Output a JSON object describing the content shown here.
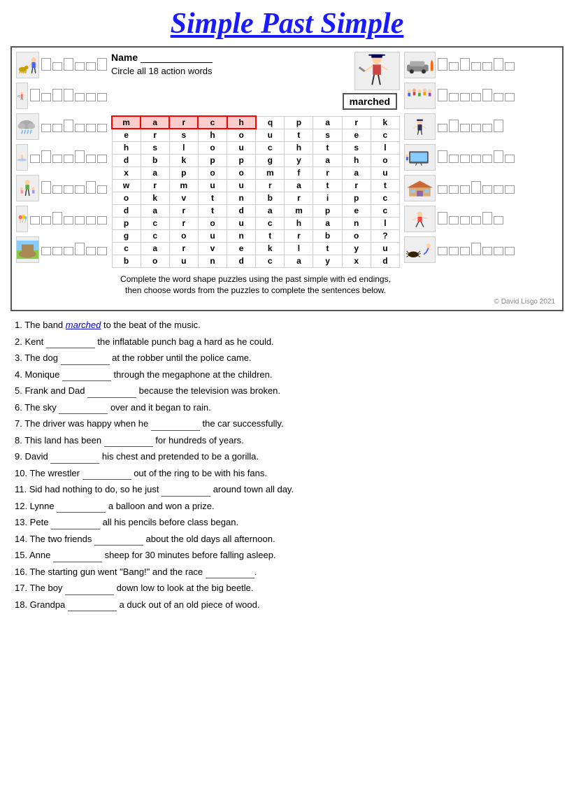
{
  "title": "Simple Past Simple",
  "header": {
    "name_label": "Name",
    "instruction": "Circle all 18 action words",
    "example_word": "marched"
  },
  "wordsearch": {
    "grid": [
      [
        "m",
        "a",
        "r",
        "c",
        "h",
        "q",
        "p",
        "a",
        "r",
        "k"
      ],
      [
        "e",
        "r",
        "s",
        "h",
        "o",
        "u",
        "t",
        "s",
        "e",
        "c"
      ],
      [
        "h",
        "s",
        "l",
        "o",
        "u",
        "c",
        "h",
        "t",
        "s",
        "l"
      ],
      [
        "d",
        "b",
        "k",
        "p",
        "p",
        "g",
        "y",
        "a",
        "h",
        "o"
      ],
      [
        "x",
        "a",
        "p",
        "o",
        "o",
        "m",
        "f",
        "r",
        "a",
        "u"
      ],
      [
        "w",
        "r",
        "m",
        "u",
        "u",
        "r",
        "a",
        "t",
        "r",
        "t"
      ],
      [
        "o",
        "k",
        "v",
        "t",
        "n",
        "b",
        "r",
        "i",
        "p",
        "c"
      ],
      [
        "d",
        "a",
        "r",
        "t",
        "d",
        "a",
        "m",
        "p",
        "e",
        "c"
      ],
      [
        "p",
        "c",
        "r",
        "o",
        "u",
        "c",
        "h",
        "a",
        "n",
        "l"
      ],
      [
        "g",
        "c",
        "o",
        "u",
        "n",
        "t",
        "r",
        "b",
        "o",
        "?"
      ],
      [
        "c",
        "a",
        "r",
        "v",
        "e",
        "k",
        "l",
        "t",
        "y",
        "u"
      ],
      [
        "b",
        "o",
        "u",
        "n",
        "d",
        "c",
        "a",
        "y",
        "x",
        "d"
      ]
    ],
    "highlighted_cells": [
      [
        0,
        0
      ],
      [
        0,
        1
      ],
      [
        0,
        2
      ],
      [
        0,
        3
      ],
      [
        0,
        4
      ]
    ]
  },
  "puzzle_text": "Complete the word shape puzzles using the past simple with ed endings, then choose words from the puzzles to complete the sentences below.",
  "sentences": [
    "1. The band <u>marched</u> to the beat of the music.",
    "2. Kent __________ the inflatable punch bag a hard as he could.",
    "3. The dog __________ at the robber until the police came.",
    "4. Monique __________ through the megaphone at the children.",
    "5. Frank and Dad __________ because the television was broken.",
    "6. The sky __________ over and it began to rain.",
    "7. The driver was happy when he __________ the car successfully.",
    "8. This land has been __________ for hundreds of years.",
    "9. David __________ his chest and pretended to be a gorilla.",
    "10. The wrestler __________ out of the ring to be with his fans.",
    "11. Sid had nothing to do, so he just __________ around town all day.",
    "12. Lynne __________ a balloon and won a prize.",
    "13. Pete __________ all his pencils before class began.",
    "14. The two friends __________ about the old days all afternoon.",
    "15. Anne __________ sheep for 30 minutes before falling asleep.",
    "16. The starting gun went \"Bang!\" and the race __________.",
    "17. The boy __________ down low to look at the big beetle.",
    "18. Grandpa __________ a duck out of an old piece of wood."
  ],
  "copyright": "© David Lisgo 2021",
  "colors": {
    "title": "#1a1aff",
    "highlight": "#ffcccc",
    "border": "#555555"
  }
}
